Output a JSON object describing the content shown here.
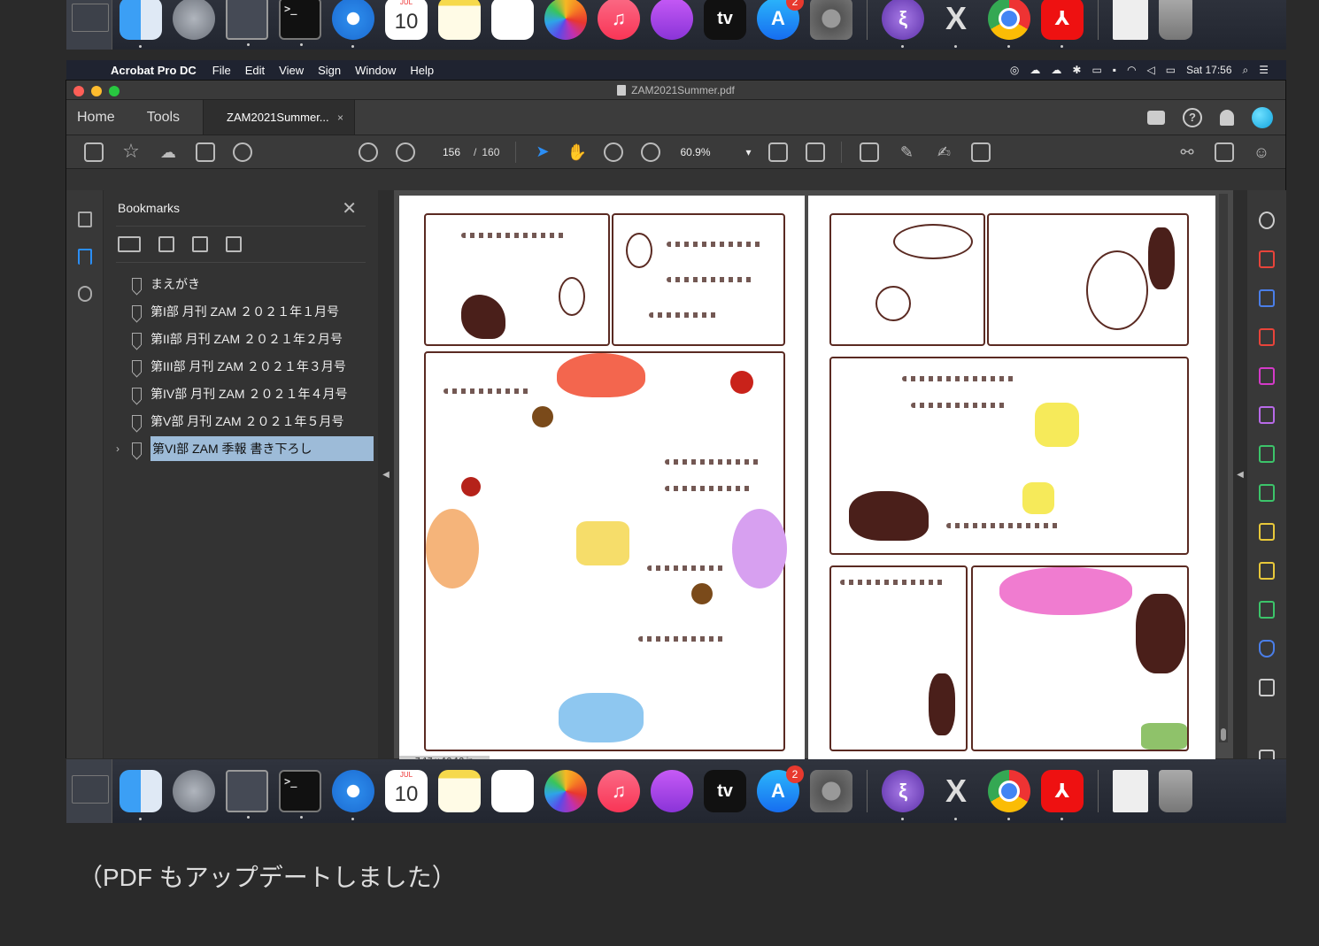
{
  "dock": {
    "calendar_month": "JUL",
    "calendar_day": "10",
    "appstore_badge": "2",
    "terminal_prompt": ">_",
    "tv_label": "tv",
    "apps": [
      "finder-icon",
      "launchpad-icon",
      "activity-monitor-icon",
      "terminal-icon",
      "safari-icon",
      "calendar-icon",
      "notes-icon",
      "reminders-icon",
      "photos-icon",
      "music-icon",
      "podcasts-icon",
      "apple-tv-icon",
      "app-store-icon",
      "system-preferences-icon",
      "emacs-icon",
      "x11-icon",
      "chrome-icon",
      "acrobat-icon",
      "document-stack-icon",
      "trash-icon"
    ]
  },
  "menubar": {
    "app_name": "Acrobat Pro DC",
    "menus": [
      "File",
      "Edit",
      "View",
      "Sign",
      "Window",
      "Help"
    ],
    "clock": "Sat 17:56"
  },
  "window": {
    "title": "ZAM2021Summer.pdf"
  },
  "tabs": {
    "home": "Home",
    "tools": "Tools",
    "document": "ZAM2021Summer...",
    "close": "×",
    "help": "?"
  },
  "toolbar": {
    "current_page": "156",
    "page_sep": "/",
    "total_pages": "160",
    "zoom": "60.9%"
  },
  "bookmarks": {
    "title": "Bookmarks",
    "close": "✕",
    "items": [
      {
        "label": "まえがき"
      },
      {
        "label": "第I部 月刊 ZAM ２０２１年１月号"
      },
      {
        "label": "第II部 月刊 ZAM ２０２１年２月号"
      },
      {
        "label": "第III部 月刊 ZAM ２０２１年３月号"
      },
      {
        "label": "第IV部 月刊 ZAM ２０２１年４月号"
      },
      {
        "label": "第V部 月刊 ZAM ２０２１年５月号"
      },
      {
        "label": "第VI部 ZAM 季報 書き下ろし",
        "selected": true
      }
    ]
  },
  "document": {
    "page_size": "7.17 x 10.12 in"
  },
  "caption": "（PDF もアップデートしました）",
  "colors": {
    "accent": "#2b8ef5",
    "selection": "#9dbbd8",
    "acrobat_red": "#e11111"
  }
}
